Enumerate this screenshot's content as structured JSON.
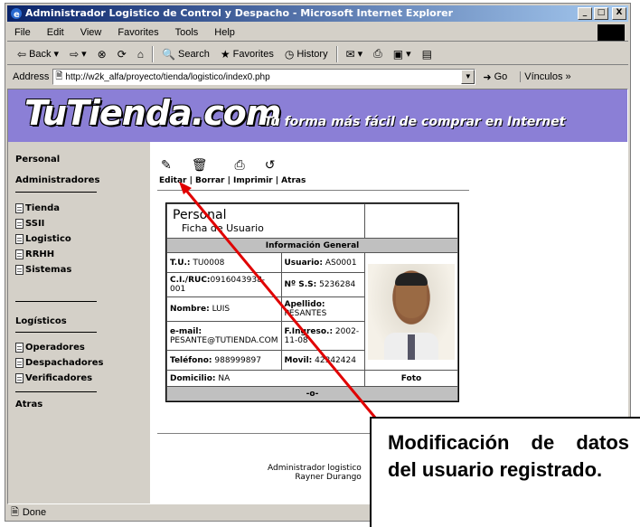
{
  "window": {
    "title": "Administrador Logistico de Control y Despacho - Microsoft Internet Explorer",
    "min_label": "_",
    "max_label": "□",
    "close_label": "X"
  },
  "menu": [
    "File",
    "Edit",
    "View",
    "Favorites",
    "Tools",
    "Help"
  ],
  "toolbar": {
    "back": "Back",
    "search": "Search",
    "favorites": "Favorites",
    "history": "History"
  },
  "address": {
    "label": "Address",
    "url": "http://w2k_alfa/proyecto/tienda/logistico/index0.php",
    "go": "Go",
    "links": "Vínculos"
  },
  "banner": {
    "logo": "TuTienda.com",
    "slogan": "Tu forma más fácil de comprar en Internet"
  },
  "sidebar": {
    "personal": "Personal",
    "administradores": "Administradores",
    "admin_items": [
      "Tienda",
      "SSII",
      "Logistico",
      "RRHH",
      "Sistemas"
    ],
    "logisticos": "Logísticos",
    "log_items": [
      "Operadores",
      "Despachadores",
      "Verificadores"
    ],
    "atras": "Atras"
  },
  "actions": {
    "labels": "Editar | Borrar | Imprimir | Atras"
  },
  "card": {
    "title": "Personal",
    "subtitle": "Ficha de Usuario",
    "section": "Información General",
    "tu_label": "T.U.:",
    "tu_value": "TU0008",
    "usuario_label": "Usuario:",
    "usuario_value": "AS0001",
    "ruc_label": "C.I./RUC:",
    "ruc_value": "0916043938-001",
    "ss_label": "Nº S.S:",
    "ss_value": "5236284",
    "nombre_label": "Nombre:",
    "nombre_value": "LUIS",
    "apellido_label": "Apellido:",
    "apellido_value": "PESANTES",
    "email_label": "e-mail:",
    "email_value": "PESANTE@TUTIENDA.COM",
    "ingreso_label": "F.Ingreso.:",
    "ingreso_value": "2002-11-08",
    "telefono_label": "Teléfono:",
    "telefono_value": "988999897",
    "movil_label": "Movil:",
    "movil_value": "42342424",
    "domicilio_label": "Domicilio:",
    "domicilio_value": "NA",
    "foto_label": "Foto",
    "footer_bar": "-o-"
  },
  "footer": {
    "line1": "Administrador logistico",
    "line2": "Rayner Durango"
  },
  "status": {
    "text": "Done"
  },
  "callout": {
    "text": "Modificación de datos del usuario registrado."
  }
}
